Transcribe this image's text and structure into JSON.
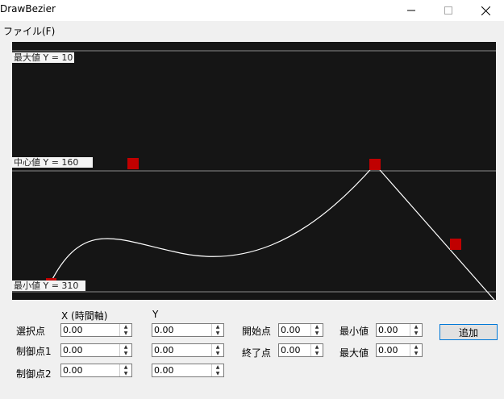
{
  "window": {
    "title": "DrawBezier"
  },
  "menu": {
    "file": "ファイル(F)"
  },
  "canvas": {
    "axis_labels": {
      "max": "最大値 Y = 10",
      "center": "中心値 Y = 160",
      "min": "最小値 Y = 310"
    },
    "colors": {
      "background": "#151515",
      "curve": "#ffffff",
      "gridline": "#8a8a8a",
      "control_point": "#c00000"
    }
  },
  "form": {
    "col_x_header": "X (時間軸)",
    "col_y_header": "Y",
    "rows": [
      {
        "label": "選択点",
        "x": "0.00",
        "y": "0.00"
      },
      {
        "label": "制御点1",
        "x": "0.00",
        "y": "0.00"
      },
      {
        "label": "制御点2",
        "x": "0.00",
        "y": "0.00"
      }
    ],
    "start_label": "開始点",
    "start_value": "0.00",
    "end_label": "終了点",
    "end_value": "0.00",
    "min_label": "最小値",
    "min_value": "0.00",
    "max_label": "最大値",
    "max_value": "0.00",
    "add_button": "追加"
  }
}
